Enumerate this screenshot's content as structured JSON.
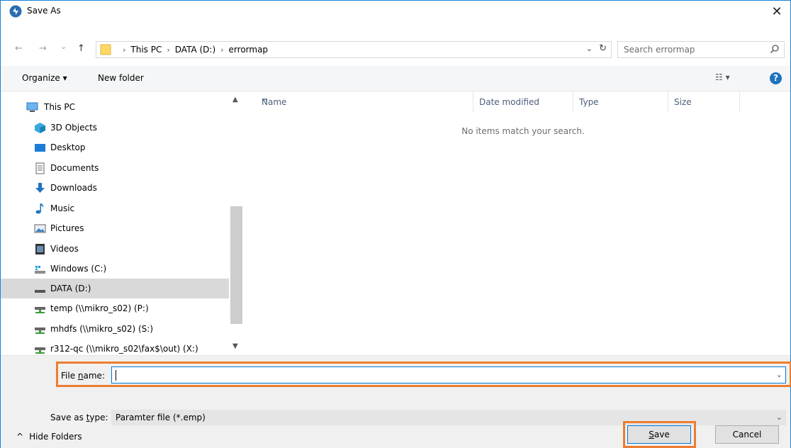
{
  "window": {
    "title": "Save As",
    "close_glyph": "✕",
    "app_icon": "app-logo-icon"
  },
  "address": {
    "back_glyph": "←",
    "forward_glyph": "→",
    "recent_glyph": "⌄",
    "up_glyph": "↑",
    "crumbs": [
      "This PC",
      "DATA (D:)",
      "errormap"
    ],
    "dropdown_glyph": "⌄",
    "refresh_glyph": "↻",
    "search_placeholder": "Search errormap"
  },
  "toolbar": {
    "organize_label": "Organize ▾",
    "new_folder_label": "New folder",
    "view_glyph": "☷ ▾",
    "help_glyph": "?"
  },
  "nav": {
    "items": [
      {
        "label": "This PC",
        "icon": "computer-icon"
      },
      {
        "label": "3D Objects",
        "icon": "3d-objects-icon"
      },
      {
        "label": "Desktop",
        "icon": "desktop-icon"
      },
      {
        "label": "Documents",
        "icon": "documents-icon"
      },
      {
        "label": "Downloads",
        "icon": "downloads-icon"
      },
      {
        "label": "Music",
        "icon": "music-icon"
      },
      {
        "label": "Pictures",
        "icon": "pictures-icon"
      },
      {
        "label": "Videos",
        "icon": "videos-icon"
      },
      {
        "label": "Windows (C:)",
        "icon": "windows-drive-icon"
      },
      {
        "label": "DATA (D:)",
        "icon": "drive-icon",
        "selected": true
      },
      {
        "label": "temp (\\\\mikro_s02) (P:)",
        "icon": "network-drive-icon"
      },
      {
        "label": "mhdfs (\\\\mikro_s02) (S:)",
        "icon": "network-drive-icon"
      },
      {
        "label": "r312-qc (\\\\mikro_s02\\fax$\\out) (X:)",
        "icon": "network-drive-icon"
      }
    ],
    "scroll_up_glyph": "▲",
    "scroll_down_glyph": "▼"
  },
  "filelist": {
    "columns": [
      "Name",
      "Date modified",
      "Type",
      "Size"
    ],
    "sort_glyph": "^",
    "empty_message": "No items match your search."
  },
  "bottom": {
    "file_name_label_pre": "File ",
    "file_name_label_ul": "n",
    "file_name_label_post": "ame:",
    "file_name_value": "",
    "save_type_label_pre": "Save as ",
    "save_type_label_ul": "t",
    "save_type_label_post": "ype:",
    "save_type_value": "Paramter file (*.emp)",
    "dropdown_glyph": "⌄",
    "hide_folders_glyph": "^",
    "hide_folders_label": "Hide Folders",
    "save_ul": "S",
    "save_rest": "ave",
    "cancel_label": "Cancel"
  },
  "colors": {
    "accent": "#0078d7",
    "highlight": "#ed7d31",
    "selected_bg": "#d9d9d9"
  }
}
